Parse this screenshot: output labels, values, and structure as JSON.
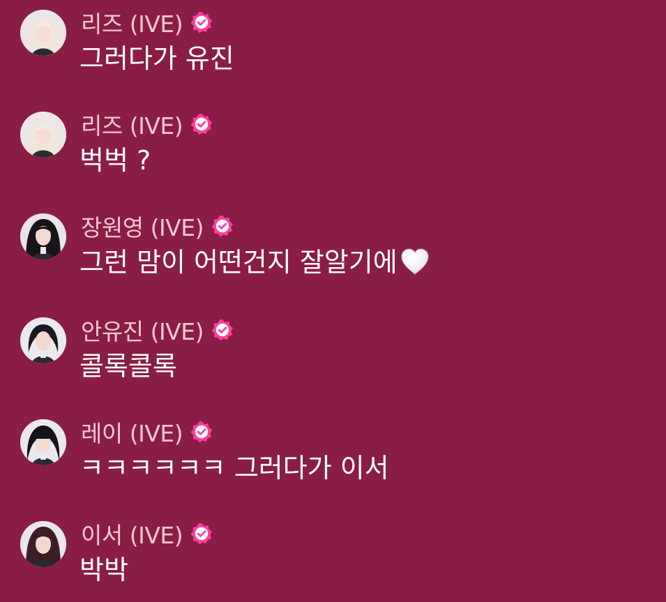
{
  "colors": {
    "background": "#8a1d45",
    "name_text": "#f2c9d8",
    "message_text": "#ffffff",
    "verified_badge": "#ff3c9e"
  },
  "messages": [
    {
      "author": "리즈 (IVE)",
      "text": "그러다가 유진",
      "avatar_icon": "avatar-liz",
      "verified": true
    },
    {
      "author": "리즈 (IVE)",
      "text": "벅벅 ?",
      "avatar_icon": "avatar-liz",
      "verified": true
    },
    {
      "author": "장원영 (IVE)",
      "text": "그런 맘이 어떤건지 잘알기에",
      "emoji": "white-heart-emoji",
      "avatar_icon": "avatar-wonyoung",
      "verified": true
    },
    {
      "author": "안유진 (IVE)",
      "text": "콜록콜록",
      "avatar_icon": "avatar-yujin",
      "verified": true
    },
    {
      "author": "레이 (IVE)",
      "text": "ㅋㅋㅋㅋㅋㅋ 그러다가 이서",
      "avatar_icon": "avatar-rei",
      "verified": true
    },
    {
      "author": "이서 (IVE)",
      "text": "박박",
      "avatar_icon": "avatar-leeseo",
      "verified": true
    }
  ]
}
